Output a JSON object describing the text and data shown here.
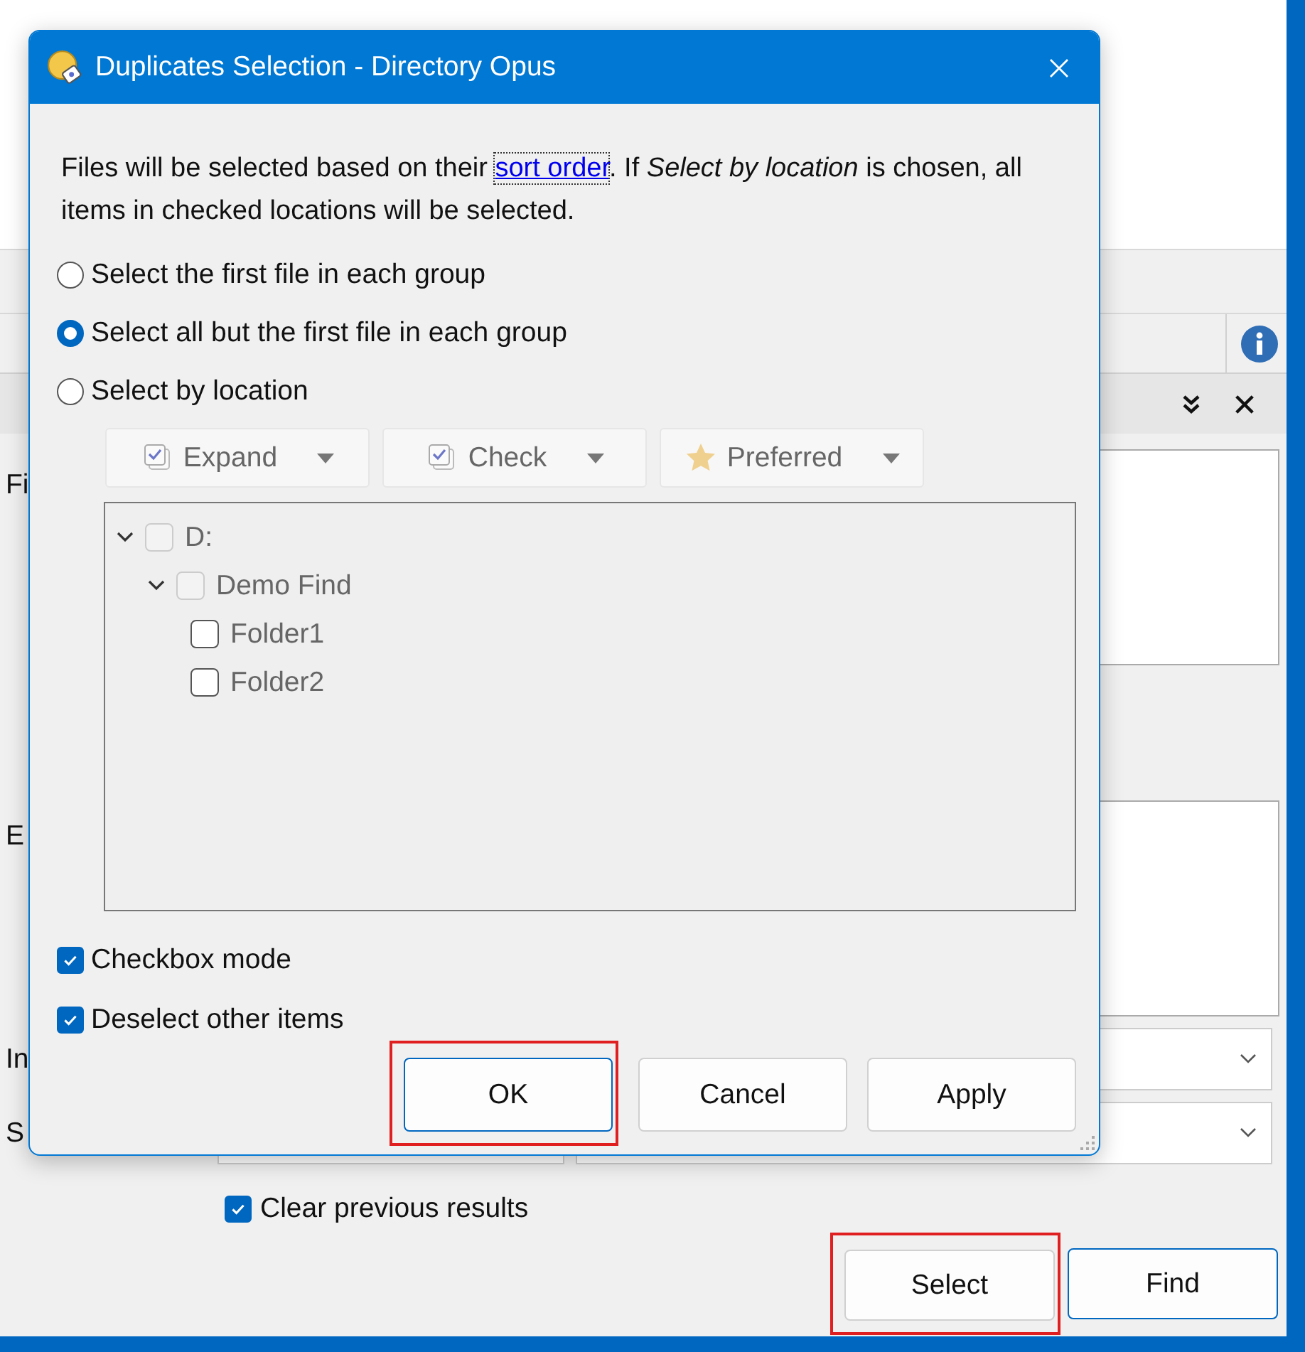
{
  "background_window": {
    "labels": [
      "Fi",
      "E",
      "In",
      "S"
    ],
    "clear_previous": {
      "label": "Clear previous results",
      "checked": true
    },
    "buttons": [
      {
        "label": "Select",
        "default": false,
        "highlighted": true
      },
      {
        "label": "Find",
        "default": true,
        "highlighted": false
      }
    ]
  },
  "dialog": {
    "title": "Duplicates Selection - Directory Opus",
    "intro": {
      "before": "Files will be selected based on their ",
      "link": "sort order",
      "after": ". If *Select by location* is chosen, all items in checked locations will be selected."
    },
    "options": [
      {
        "label": "Select the first file in each group",
        "selected": false
      },
      {
        "label": "Select all but the first file in each group",
        "selected": true
      },
      {
        "label": "Select by location",
        "selected": false
      }
    ],
    "toolbar": [
      {
        "label": "Expand",
        "kind": "stack"
      },
      {
        "label": "Check",
        "kind": "stack"
      },
      {
        "label": "Preferred",
        "kind": "star"
      }
    ],
    "tree": [
      {
        "label": "D:",
        "expanded": true,
        "checked": false,
        "disabled": true,
        "children": [
          {
            "label": "Demo Find",
            "expanded": true,
            "checked": false,
            "disabled": true,
            "children": [
              {
                "label": "Folder1",
                "checked": false,
                "disabled": false
              },
              {
                "label": "Folder2",
                "checked": false,
                "disabled": false
              }
            ]
          }
        ]
      }
    ],
    "checkboxes": [
      {
        "label": "Checkbox mode",
        "checked": true
      },
      {
        "label": "Deselect other items",
        "checked": true
      }
    ],
    "buttons": [
      {
        "label": "OK",
        "default": true,
        "highlighted": true
      },
      {
        "label": "Cancel",
        "default": false,
        "highlighted": false
      },
      {
        "label": "Apply",
        "default": false,
        "highlighted": false
      }
    ]
  }
}
